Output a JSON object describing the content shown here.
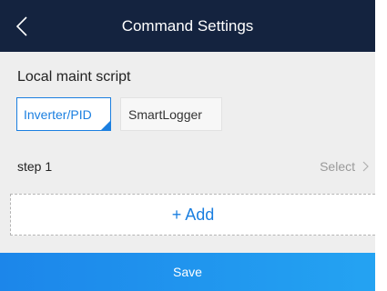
{
  "header": {
    "title": "Command Settings",
    "back_icon": "chevron-left-icon"
  },
  "script_section": {
    "title": "Local maint script",
    "tabs": [
      {
        "label": "Inverter/PID",
        "selected": true
      },
      {
        "label": "SmartLogger",
        "selected": false
      }
    ]
  },
  "steps": [
    {
      "label": "step 1",
      "action": "Select",
      "icon": "chevron-right-icon"
    }
  ],
  "add_button": {
    "label": "+ Add"
  },
  "save_button": {
    "label": "Save"
  },
  "colors": {
    "header_bg": "#14233f",
    "accent": "#1b7fe0",
    "page_bg": "#eeeeee",
    "save_gradient_start": "#1c86ea",
    "save_gradient_end": "#24a3f2"
  }
}
